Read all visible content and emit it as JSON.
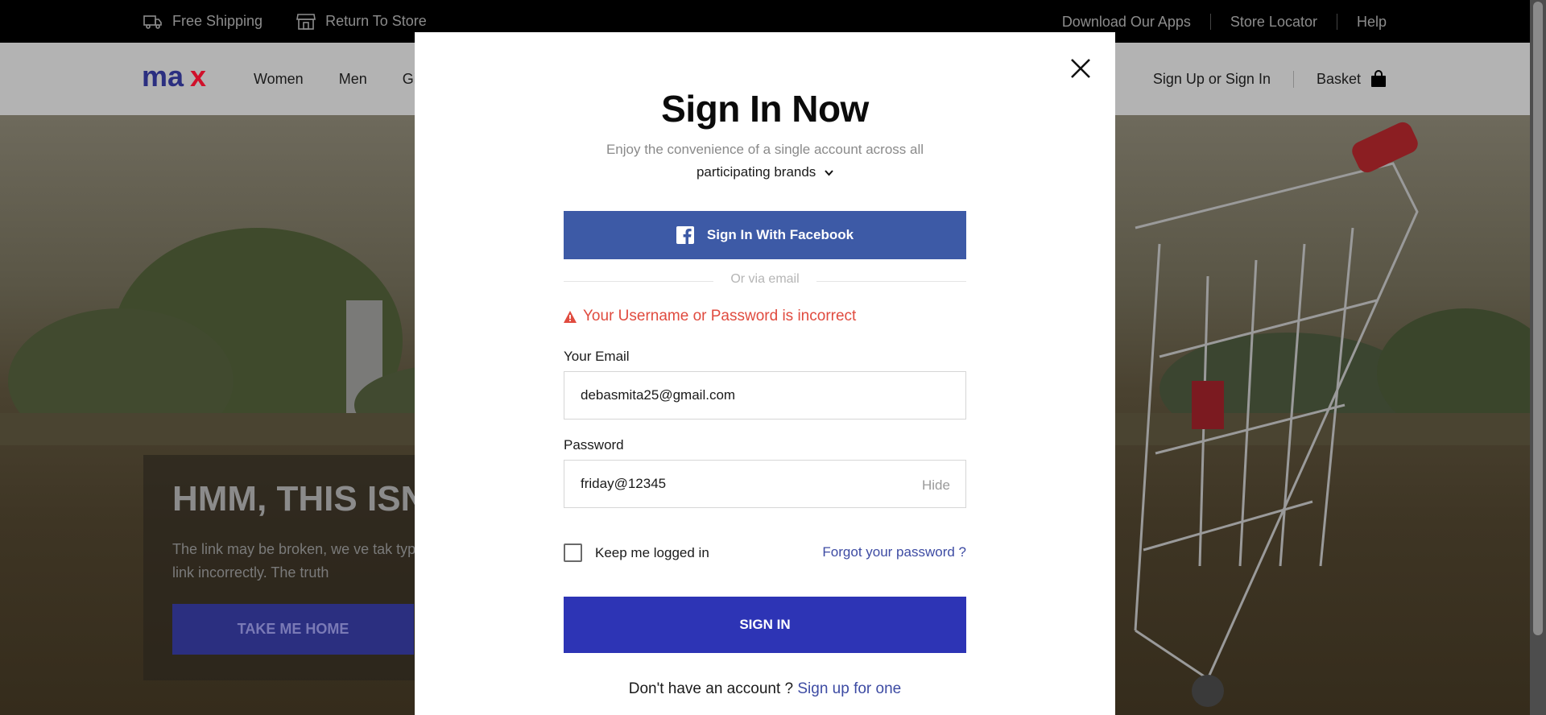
{
  "topbar": {
    "free_shipping": "Free Shipping",
    "return_to_store": "Return To Store",
    "download_apps": "Download Our Apps",
    "store_locator": "Store Locator",
    "help": "Help"
  },
  "header": {
    "logo_text": "max",
    "nav": [
      "Women",
      "Men",
      "Gi"
    ],
    "signup_signin": "Sign Up or Sign In",
    "basket": "Basket"
  },
  "hero": {
    "title": "HMM, THIS ISN",
    "text": "The link may be broken, we ve tak typed the link incorrectly. The truth",
    "button": "TAKE ME HOME"
  },
  "modal": {
    "title": "Sign In Now",
    "subtitle": "Enjoy the convenience of a single account across all",
    "brands_toggle": "participating brands",
    "facebook_button": "Sign In With Facebook",
    "divider_text": "Or via email",
    "error_message": "Your Username or Password is incorrect",
    "email_label": "Your Email",
    "email_value": "debasmita25@gmail.com",
    "password_label": "Password",
    "password_value": "friday@12345",
    "hide_label": "Hide",
    "keep_logged_in": "Keep me logged in",
    "forgot_password": "Forgot your password ?",
    "signin_button": "SIGN IN",
    "no_account_text": "Don't have an account ?",
    "signup_link": "Sign up for one"
  },
  "colors": {
    "brand_blue": "#2d34b5",
    "facebook_blue": "#3d5aa6",
    "error_red": "#e04b3f",
    "link_blue": "#3d4ba3",
    "logo_red": "#d0112b",
    "logo_navy": "#2b2f80"
  },
  "icons": {
    "truck": "truck-icon",
    "store": "store-icon",
    "basket": "shopping-bag-icon",
    "close": "close-icon",
    "facebook": "facebook-icon",
    "warning": "warning-icon",
    "chevron": "chevron-down-icon"
  }
}
